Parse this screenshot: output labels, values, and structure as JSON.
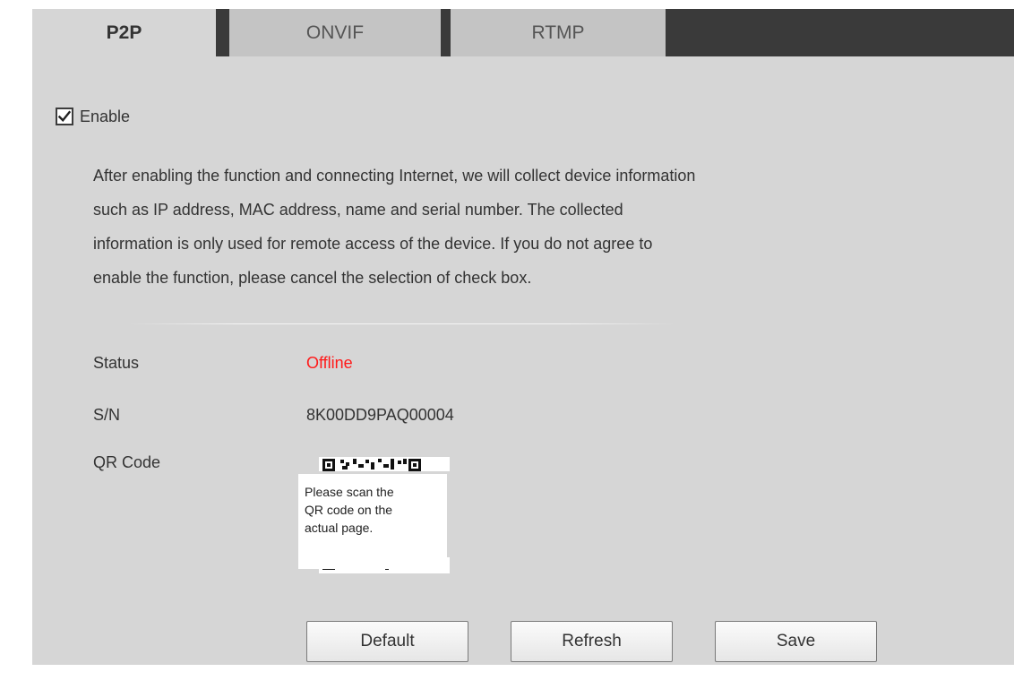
{
  "tabs": [
    {
      "label": "P2P"
    },
    {
      "label": "ONVIF"
    },
    {
      "label": "RTMP"
    }
  ],
  "enable": {
    "label": "Enable",
    "checked": true
  },
  "description": {
    "lines": [
      "After enabling the function and connecting Internet, we will collect device information",
      "such as IP address, MAC address, name and serial number. The collected",
      "information is only used for remote access of the device. If you do not agree to",
      "enable the function, please cancel the selection of check box."
    ]
  },
  "fields": {
    "status": {
      "label": "Status",
      "value": "Offline",
      "value_color": "#ff1a1a"
    },
    "sn": {
      "label": "S/N",
      "value": "8K00DD9PAQ00004"
    },
    "qr": {
      "label": "QR Code",
      "notice_lines": [
        "Please scan the",
        "QR code on the",
        "actual page."
      ]
    }
  },
  "buttons": {
    "default": "Default",
    "refresh": "Refresh",
    "save": "Save"
  },
  "colors": {
    "panel_bg": "#d6d6d6",
    "tabbar_bg": "#3a3a3a",
    "inactive_tab_bg": "#c4c4c4",
    "status_offline": "#ff1a1a"
  },
  "icons": {
    "checkbox": "checkmark-icon",
    "qr": "qr-code-icon"
  }
}
